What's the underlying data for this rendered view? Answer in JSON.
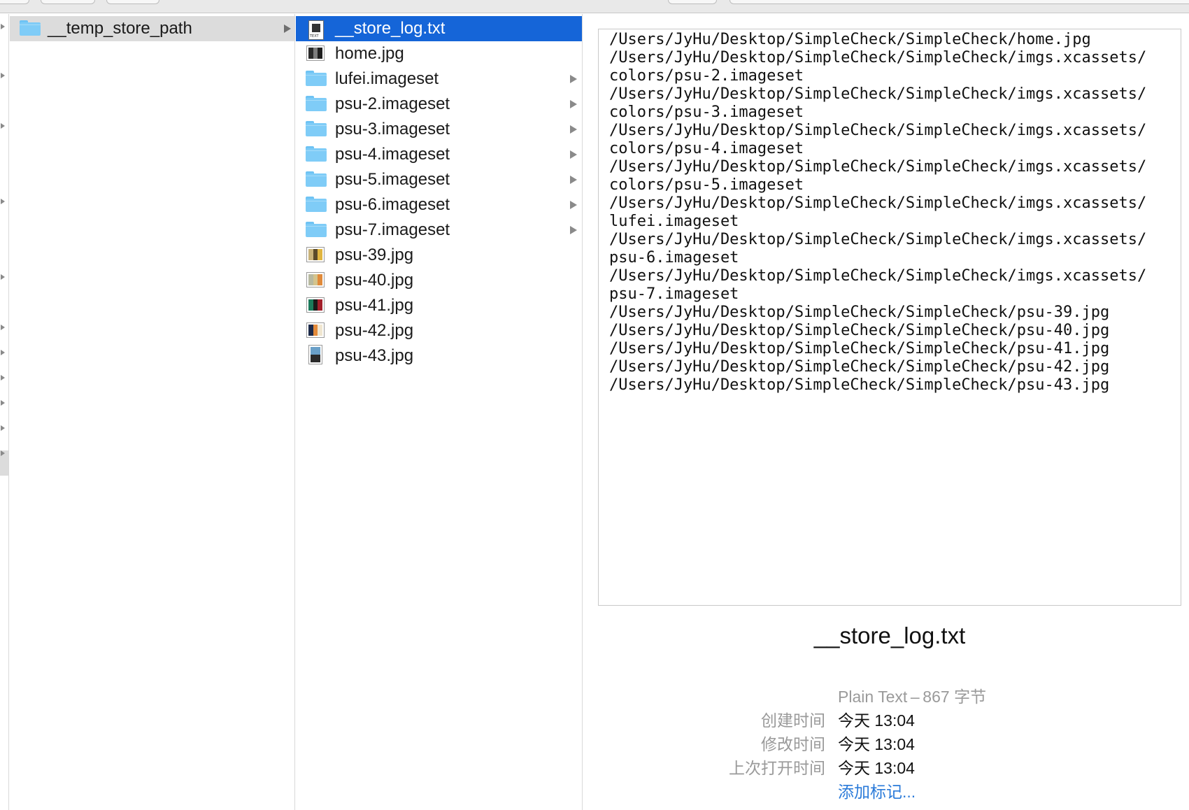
{
  "column1": {
    "items": [
      {
        "name": "__temp_store_path",
        "type": "folder",
        "selected": true
      }
    ]
  },
  "column2": {
    "items": [
      {
        "name": "__store_log.txt",
        "type": "text",
        "selected": true
      },
      {
        "name": "home.jpg",
        "type": "image"
      },
      {
        "name": "lufei.imageset",
        "type": "folder"
      },
      {
        "name": "psu-2.imageset",
        "type": "folder"
      },
      {
        "name": "psu-3.imageset",
        "type": "folder"
      },
      {
        "name": "psu-4.imageset",
        "type": "folder"
      },
      {
        "name": "psu-5.imageset",
        "type": "folder"
      },
      {
        "name": "psu-6.imageset",
        "type": "folder"
      },
      {
        "name": "psu-7.imageset",
        "type": "folder"
      },
      {
        "name": "psu-39.jpg",
        "type": "image"
      },
      {
        "name": "psu-40.jpg",
        "type": "image"
      },
      {
        "name": "psu-41.jpg",
        "type": "image"
      },
      {
        "name": "psu-42.jpg",
        "type": "image"
      },
      {
        "name": "psu-43.jpg",
        "type": "image"
      }
    ]
  },
  "preview": {
    "lines": [
      "/Users/JyHu/Desktop/SimpleCheck/SimpleCheck/home.jpg",
      "/Users/JyHu/Desktop/SimpleCheck/SimpleCheck/imgs.xcassets/",
      "colors/psu-2.imageset",
      "/Users/JyHu/Desktop/SimpleCheck/SimpleCheck/imgs.xcassets/",
      "colors/psu-3.imageset",
      "/Users/JyHu/Desktop/SimpleCheck/SimpleCheck/imgs.xcassets/",
      "colors/psu-4.imageset",
      "/Users/JyHu/Desktop/SimpleCheck/SimpleCheck/imgs.xcassets/",
      "colors/psu-5.imageset",
      "/Users/JyHu/Desktop/SimpleCheck/SimpleCheck/imgs.xcassets/",
      "lufei.imageset",
      "/Users/JyHu/Desktop/SimpleCheck/SimpleCheck/imgs.xcassets/",
      "psu-6.imageset",
      "/Users/JyHu/Desktop/SimpleCheck/SimpleCheck/imgs.xcassets/",
      "psu-7.imageset",
      "/Users/JyHu/Desktop/SimpleCheck/SimpleCheck/psu-39.jpg",
      "/Users/JyHu/Desktop/SimpleCheck/SimpleCheck/psu-40.jpg",
      "/Users/JyHu/Desktop/SimpleCheck/SimpleCheck/psu-41.jpg",
      "/Users/JyHu/Desktop/SimpleCheck/SimpleCheck/psu-42.jpg",
      "/Users/JyHu/Desktop/SimpleCheck/SimpleCheck/psu-43.jpg"
    ],
    "filename": "__store_log.txt",
    "kind": "Plain Text – 867 字节",
    "created_label": "创建时间",
    "created_value": "今天 13:04",
    "modified_label": "修改时间",
    "modified_value": "今天 13:04",
    "opened_label": "上次打开时间",
    "opened_value": "今天 13:04",
    "add_tags": "添加标记..."
  },
  "colors": {
    "selection_blue": "#1565d8",
    "selection_grey": "#dcdcdc",
    "folder": "#7fccf7",
    "link": "#2a7ad9"
  }
}
